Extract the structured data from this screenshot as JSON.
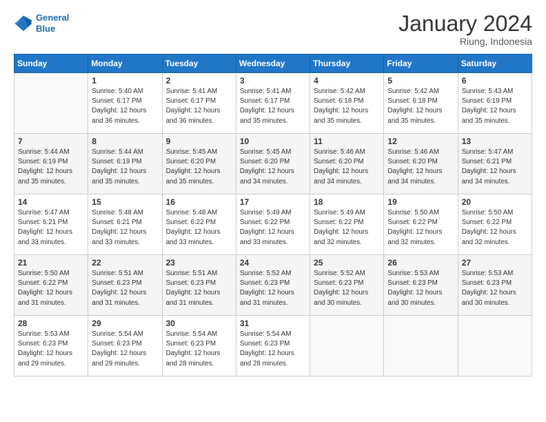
{
  "logo": {
    "line1": "General",
    "line2": "Blue"
  },
  "title": "January 2024",
  "location": "Riung, Indonesia",
  "weekdays": [
    "Sunday",
    "Monday",
    "Tuesday",
    "Wednesday",
    "Thursday",
    "Friday",
    "Saturday"
  ],
  "weeks": [
    [
      {
        "day": "",
        "sunrise": "",
        "sunset": "",
        "daylight": ""
      },
      {
        "day": "1",
        "sunrise": "Sunrise: 5:40 AM",
        "sunset": "Sunset: 6:17 PM",
        "daylight": "Daylight: 12 hours and 36 minutes."
      },
      {
        "day": "2",
        "sunrise": "Sunrise: 5:41 AM",
        "sunset": "Sunset: 6:17 PM",
        "daylight": "Daylight: 12 hours and 36 minutes."
      },
      {
        "day": "3",
        "sunrise": "Sunrise: 5:41 AM",
        "sunset": "Sunset: 6:17 PM",
        "daylight": "Daylight: 12 hours and 35 minutes."
      },
      {
        "day": "4",
        "sunrise": "Sunrise: 5:42 AM",
        "sunset": "Sunset: 6:18 PM",
        "daylight": "Daylight: 12 hours and 35 minutes."
      },
      {
        "day": "5",
        "sunrise": "Sunrise: 5:42 AM",
        "sunset": "Sunset: 6:18 PM",
        "daylight": "Daylight: 12 hours and 35 minutes."
      },
      {
        "day": "6",
        "sunrise": "Sunrise: 5:43 AM",
        "sunset": "Sunset: 6:19 PM",
        "daylight": "Daylight: 12 hours and 35 minutes."
      }
    ],
    [
      {
        "day": "7",
        "sunrise": "Sunrise: 5:44 AM",
        "sunset": "Sunset: 6:19 PM",
        "daylight": "Daylight: 12 hours and 35 minutes."
      },
      {
        "day": "8",
        "sunrise": "Sunrise: 5:44 AM",
        "sunset": "Sunset: 6:19 PM",
        "daylight": "Daylight: 12 hours and 35 minutes."
      },
      {
        "day": "9",
        "sunrise": "Sunrise: 5:45 AM",
        "sunset": "Sunset: 6:20 PM",
        "daylight": "Daylight: 12 hours and 35 minutes."
      },
      {
        "day": "10",
        "sunrise": "Sunrise: 5:45 AM",
        "sunset": "Sunset: 6:20 PM",
        "daylight": "Daylight: 12 hours and 34 minutes."
      },
      {
        "day": "11",
        "sunrise": "Sunrise: 5:46 AM",
        "sunset": "Sunset: 6:20 PM",
        "daylight": "Daylight: 12 hours and 34 minutes."
      },
      {
        "day": "12",
        "sunrise": "Sunrise: 5:46 AM",
        "sunset": "Sunset: 6:20 PM",
        "daylight": "Daylight: 12 hours and 34 minutes."
      },
      {
        "day": "13",
        "sunrise": "Sunrise: 5:47 AM",
        "sunset": "Sunset: 6:21 PM",
        "daylight": "Daylight: 12 hours and 34 minutes."
      }
    ],
    [
      {
        "day": "14",
        "sunrise": "Sunrise: 5:47 AM",
        "sunset": "Sunset: 6:21 PM",
        "daylight": "Daylight: 12 hours and 33 minutes."
      },
      {
        "day": "15",
        "sunrise": "Sunrise: 5:48 AM",
        "sunset": "Sunset: 6:21 PM",
        "daylight": "Daylight: 12 hours and 33 minutes."
      },
      {
        "day": "16",
        "sunrise": "Sunrise: 5:48 AM",
        "sunset": "Sunset: 6:22 PM",
        "daylight": "Daylight: 12 hours and 33 minutes."
      },
      {
        "day": "17",
        "sunrise": "Sunrise: 5:49 AM",
        "sunset": "Sunset: 6:22 PM",
        "daylight": "Daylight: 12 hours and 33 minutes."
      },
      {
        "day": "18",
        "sunrise": "Sunrise: 5:49 AM",
        "sunset": "Sunset: 6:22 PM",
        "daylight": "Daylight: 12 hours and 32 minutes."
      },
      {
        "day": "19",
        "sunrise": "Sunrise: 5:50 AM",
        "sunset": "Sunset: 6:22 PM",
        "daylight": "Daylight: 12 hours and 32 minutes."
      },
      {
        "day": "20",
        "sunrise": "Sunrise: 5:50 AM",
        "sunset": "Sunset: 6:22 PM",
        "daylight": "Daylight: 12 hours and 32 minutes."
      }
    ],
    [
      {
        "day": "21",
        "sunrise": "Sunrise: 5:50 AM",
        "sunset": "Sunset: 6:22 PM",
        "daylight": "Daylight: 12 hours and 31 minutes."
      },
      {
        "day": "22",
        "sunrise": "Sunrise: 5:51 AM",
        "sunset": "Sunset: 6:23 PM",
        "daylight": "Daylight: 12 hours and 31 minutes."
      },
      {
        "day": "23",
        "sunrise": "Sunrise: 5:51 AM",
        "sunset": "Sunset: 6:23 PM",
        "daylight": "Daylight: 12 hours and 31 minutes."
      },
      {
        "day": "24",
        "sunrise": "Sunrise: 5:52 AM",
        "sunset": "Sunset: 6:23 PM",
        "daylight": "Daylight: 12 hours and 31 minutes."
      },
      {
        "day": "25",
        "sunrise": "Sunrise: 5:52 AM",
        "sunset": "Sunset: 6:23 PM",
        "daylight": "Daylight: 12 hours and 30 minutes."
      },
      {
        "day": "26",
        "sunrise": "Sunrise: 5:53 AM",
        "sunset": "Sunset: 6:23 PM",
        "daylight": "Daylight: 12 hours and 30 minutes."
      },
      {
        "day": "27",
        "sunrise": "Sunrise: 5:53 AM",
        "sunset": "Sunset: 6:23 PM",
        "daylight": "Daylight: 12 hours and 30 minutes."
      }
    ],
    [
      {
        "day": "28",
        "sunrise": "Sunrise: 5:53 AM",
        "sunset": "Sunset: 6:23 PM",
        "daylight": "Daylight: 12 hours and 29 minutes."
      },
      {
        "day": "29",
        "sunrise": "Sunrise: 5:54 AM",
        "sunset": "Sunset: 6:23 PM",
        "daylight": "Daylight: 12 hours and 29 minutes."
      },
      {
        "day": "30",
        "sunrise": "Sunrise: 5:54 AM",
        "sunset": "Sunset: 6:23 PM",
        "daylight": "Daylight: 12 hours and 28 minutes."
      },
      {
        "day": "31",
        "sunrise": "Sunrise: 5:54 AM",
        "sunset": "Sunset: 6:23 PM",
        "daylight": "Daylight: 12 hours and 28 minutes."
      },
      {
        "day": "",
        "sunrise": "",
        "sunset": "",
        "daylight": ""
      },
      {
        "day": "",
        "sunrise": "",
        "sunset": "",
        "daylight": ""
      },
      {
        "day": "",
        "sunrise": "",
        "sunset": "",
        "daylight": ""
      }
    ]
  ]
}
